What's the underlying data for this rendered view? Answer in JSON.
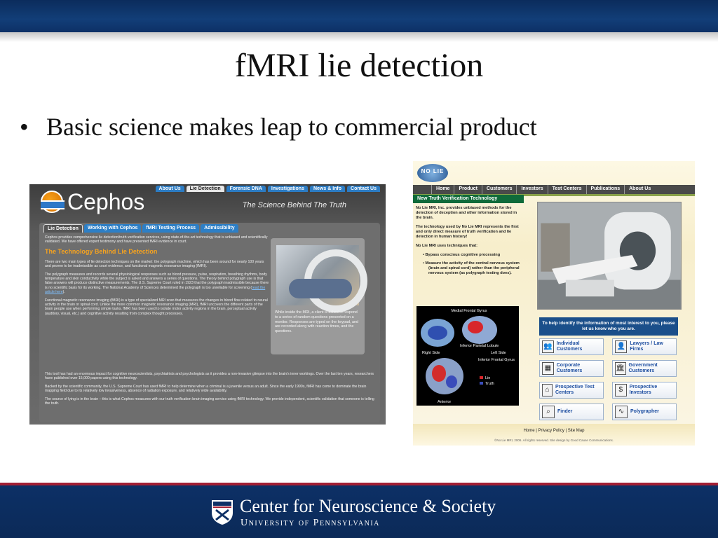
{
  "slide": {
    "title": "fMRI lie detection",
    "bullet_glyph": "•",
    "bullet": "Basic science makes leap to commercial product",
    "footer_main": "Center for Neuroscience & Society",
    "footer_sub": "University of Pennsylvania"
  },
  "cephos": {
    "logo": "Cephos",
    "tagline": "The Science Behind The Truth",
    "nav": [
      "About Us",
      "Lie Detection",
      "Forensic DNA",
      "Investigations",
      "News & Info",
      "Contact Us"
    ],
    "tabs": [
      "Lie Detection",
      "Working with Cephos",
      "fMRI Testing Process",
      "Admissibility"
    ],
    "intro": "Cephos provides comprehensive lie detection/truth verification services, using state-of-the-art technology that is unbiased and scientifically validated. We have offered expert testimony and have presented fMRI evidence in court.",
    "heading": "The Technology Behind Lie Detection",
    "p1": "There are two main types of lie detection techniques on the market: the polygraph machine, which has been around for nearly 100 years and proven to be inadmissible as court evidence, and functional magnetic resonance imaging (fMRI).",
    "p2": "The polygraph measures and records several physiological responses such as blood pressure, pulse, respiration, breathing rhythms, body temperature and skin conductivity while the subject is asked and answers a series of questions. The theory behind polygraph use is that false answers will produce distinctive measurements. The U.S. Supreme Court ruled in 1923 that the polygraph inadmissible because there is no scientific basis for its working. The National Academy of Sciences determined the polygraph is too unreliable for screening (",
    "p2_link": "read the article here",
    "p2_end": ").",
    "p3": "Functional magnetic resonance imaging (fMRI) is a type of specialized MRI scan that measures the changes in blood flow related to neural activity in the brain or spinal cord. Unlike the more common magnetic resonance imaging (MRI), fMRI uncovers the different parts of the brain people use when performing simple tasks. fMRI has been used to isolate motor activity regions in the brain, perceptual activity (auditory, visual, etc.) and cognitive activity resulting from complex thought processes.",
    "p4": "This tool has had an enormous impact for cognitive neuroscientists, psychiatrists and psychologists as it provides a non-invasive glimpse into the brain's inner workings. Over the last ten years, researchers have published over 15,000 papers using this technology.",
    "p5": "Backed by the scientific community, the U.S. Supreme Court has used fMRI to help determine when a criminal is a juvenile versus an adult. Since the early 1990s, fMRI has come to dominate the brain mapping field due to its relatively low invasiveness, absence of radiation exposure, and relatively wide availability.",
    "p6": "The source of lying is in the brain – this is what Cephos measures with our truth verification brain imaging service using fMRI technology. We provide independent, scientific validation that someone is telling the truth.",
    "caption": "While inside the MRI, a client is asked to respond to a series of random questions presented on a monitor. Responses are typed on the keypad, and are recorded along with reaction times, and the questions."
  },
  "nolie": {
    "logo": "NO LIE",
    "nav": [
      "Home",
      "Product",
      "Customers",
      "Investors",
      "Test Centers",
      "Publications",
      "About Us"
    ],
    "left_header": "New Truth Verification Technology",
    "t1": "No Lie MRI, Inc. provides unbiased methods for the detection of deception and other information stored in the brain.",
    "t2": "The technology used by No Lie MRI represents the first and only direct measure of truth verification and lie detection in human history!",
    "t3": "No Lie MRI uses techniques that:",
    "b1": "Bypass conscious cognitive processing",
    "b2": "Measure the activity of the central nervous system (brain and spinal cord) rather than the peripheral nervous system (as polygraph testing does).",
    "brain_labels": {
      "medial_frontal": "Medial Frontal Gyrus",
      "inferior_parietal": "Inferior Parietal Lobule",
      "inferior_frontal": "Inferior Frontal Gyrus",
      "right_side": "Right Side",
      "left_side": "Left Side",
      "anterior": "Anterior",
      "lie": "Lie",
      "truth": "Truth"
    },
    "contact": "To help identify the information of most interest to you, please let us know who you are.",
    "buttons": [
      {
        "label": "Individual Customers",
        "icon": "👥"
      },
      {
        "label": "Lawyers / Law Firms",
        "icon": "👤"
      },
      {
        "label": "Corporate Customers",
        "icon": "▦"
      },
      {
        "label": "Government Customers",
        "icon": "🏛"
      },
      {
        "label": "Prospective Test Centers",
        "icon": "⌂"
      },
      {
        "label": "Prospective Investors",
        "icon": "$"
      },
      {
        "label": "Finder",
        "icon": "⌕"
      },
      {
        "label": "Polygrapher",
        "icon": "∿"
      }
    ],
    "footer_links": "Home  |  Privacy Policy  |  Site Map",
    "footer_copy": "©No Lie MRI, 2006. All rights reserved. Site design by Good Cause Communications."
  },
  "colors": {
    "band": "#0d3066",
    "accent_red": "#a31f34",
    "cephos_orange": "#f6a31f",
    "cephos_blue": "#2c7cc4",
    "nolie_green": "#0f6b3a"
  }
}
